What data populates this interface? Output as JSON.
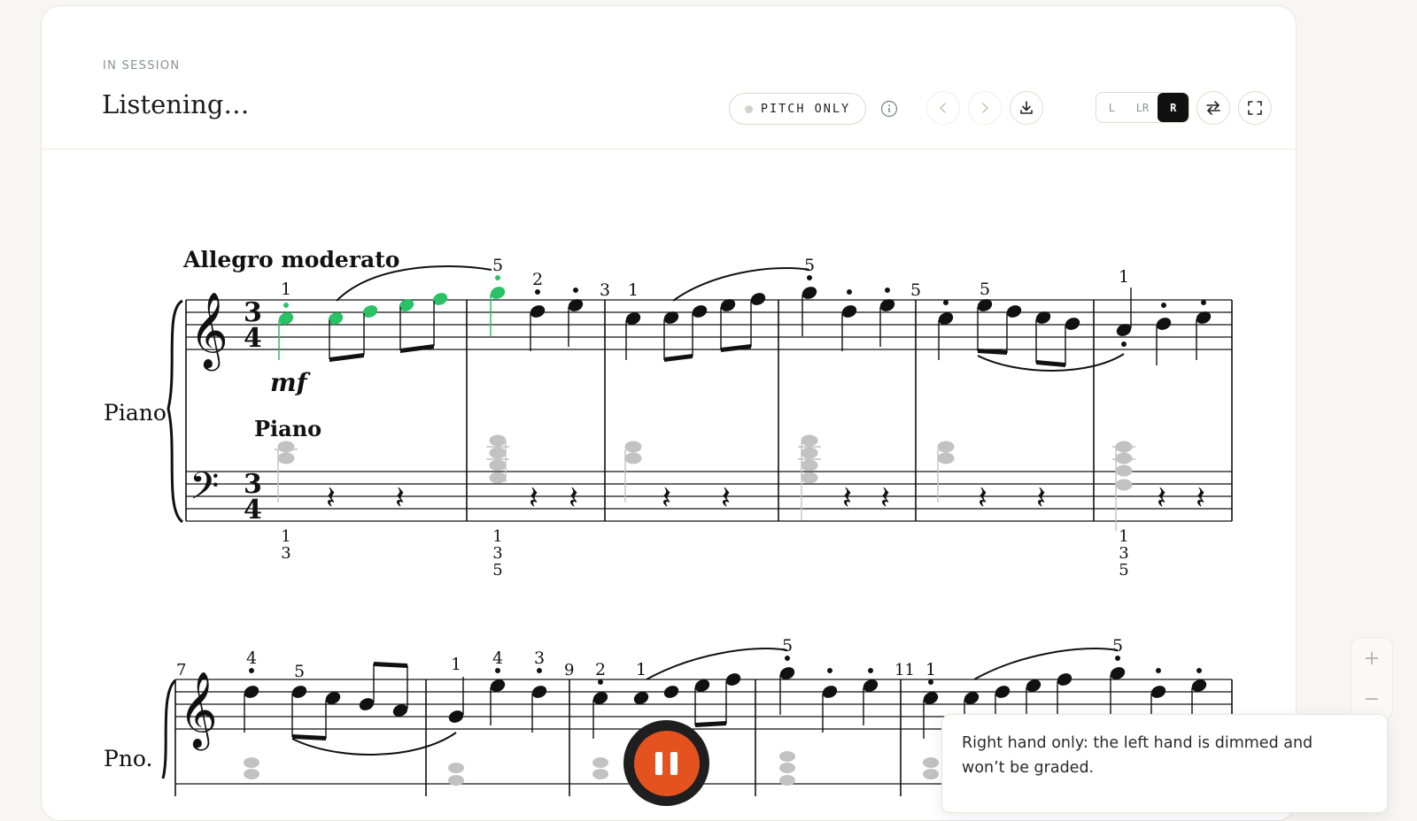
{
  "header": {
    "eyebrow": "IN SESSION",
    "title": "Listening…",
    "mode_pill": "PITCH ONLY",
    "hand_options": [
      "L",
      "LR",
      "R"
    ],
    "selected_hand": "R"
  },
  "score": {
    "tempo": "Allegro moderato",
    "dynamic": "mf",
    "instrument_full": "Piano",
    "instrument_short": "Pno.",
    "staff_label": "Piano",
    "time_signature": [
      "3",
      "4"
    ],
    "measure_numbers": [
      "7",
      "9",
      "11"
    ]
  },
  "toast": {
    "message": "Right hand only: the left hand is dimmed and won’t be graded."
  },
  "colors": {
    "accent_green": "#2bc167",
    "pause_orange": "#e4531f",
    "dimmed_notes": "#bdbdbd"
  },
  "icons": [
    "info-icon",
    "chevron-left-icon",
    "chevron-right-icon",
    "download-icon",
    "swap-icon",
    "fullscreen-icon",
    "plus-icon",
    "minus-icon",
    "pause-icon"
  ]
}
